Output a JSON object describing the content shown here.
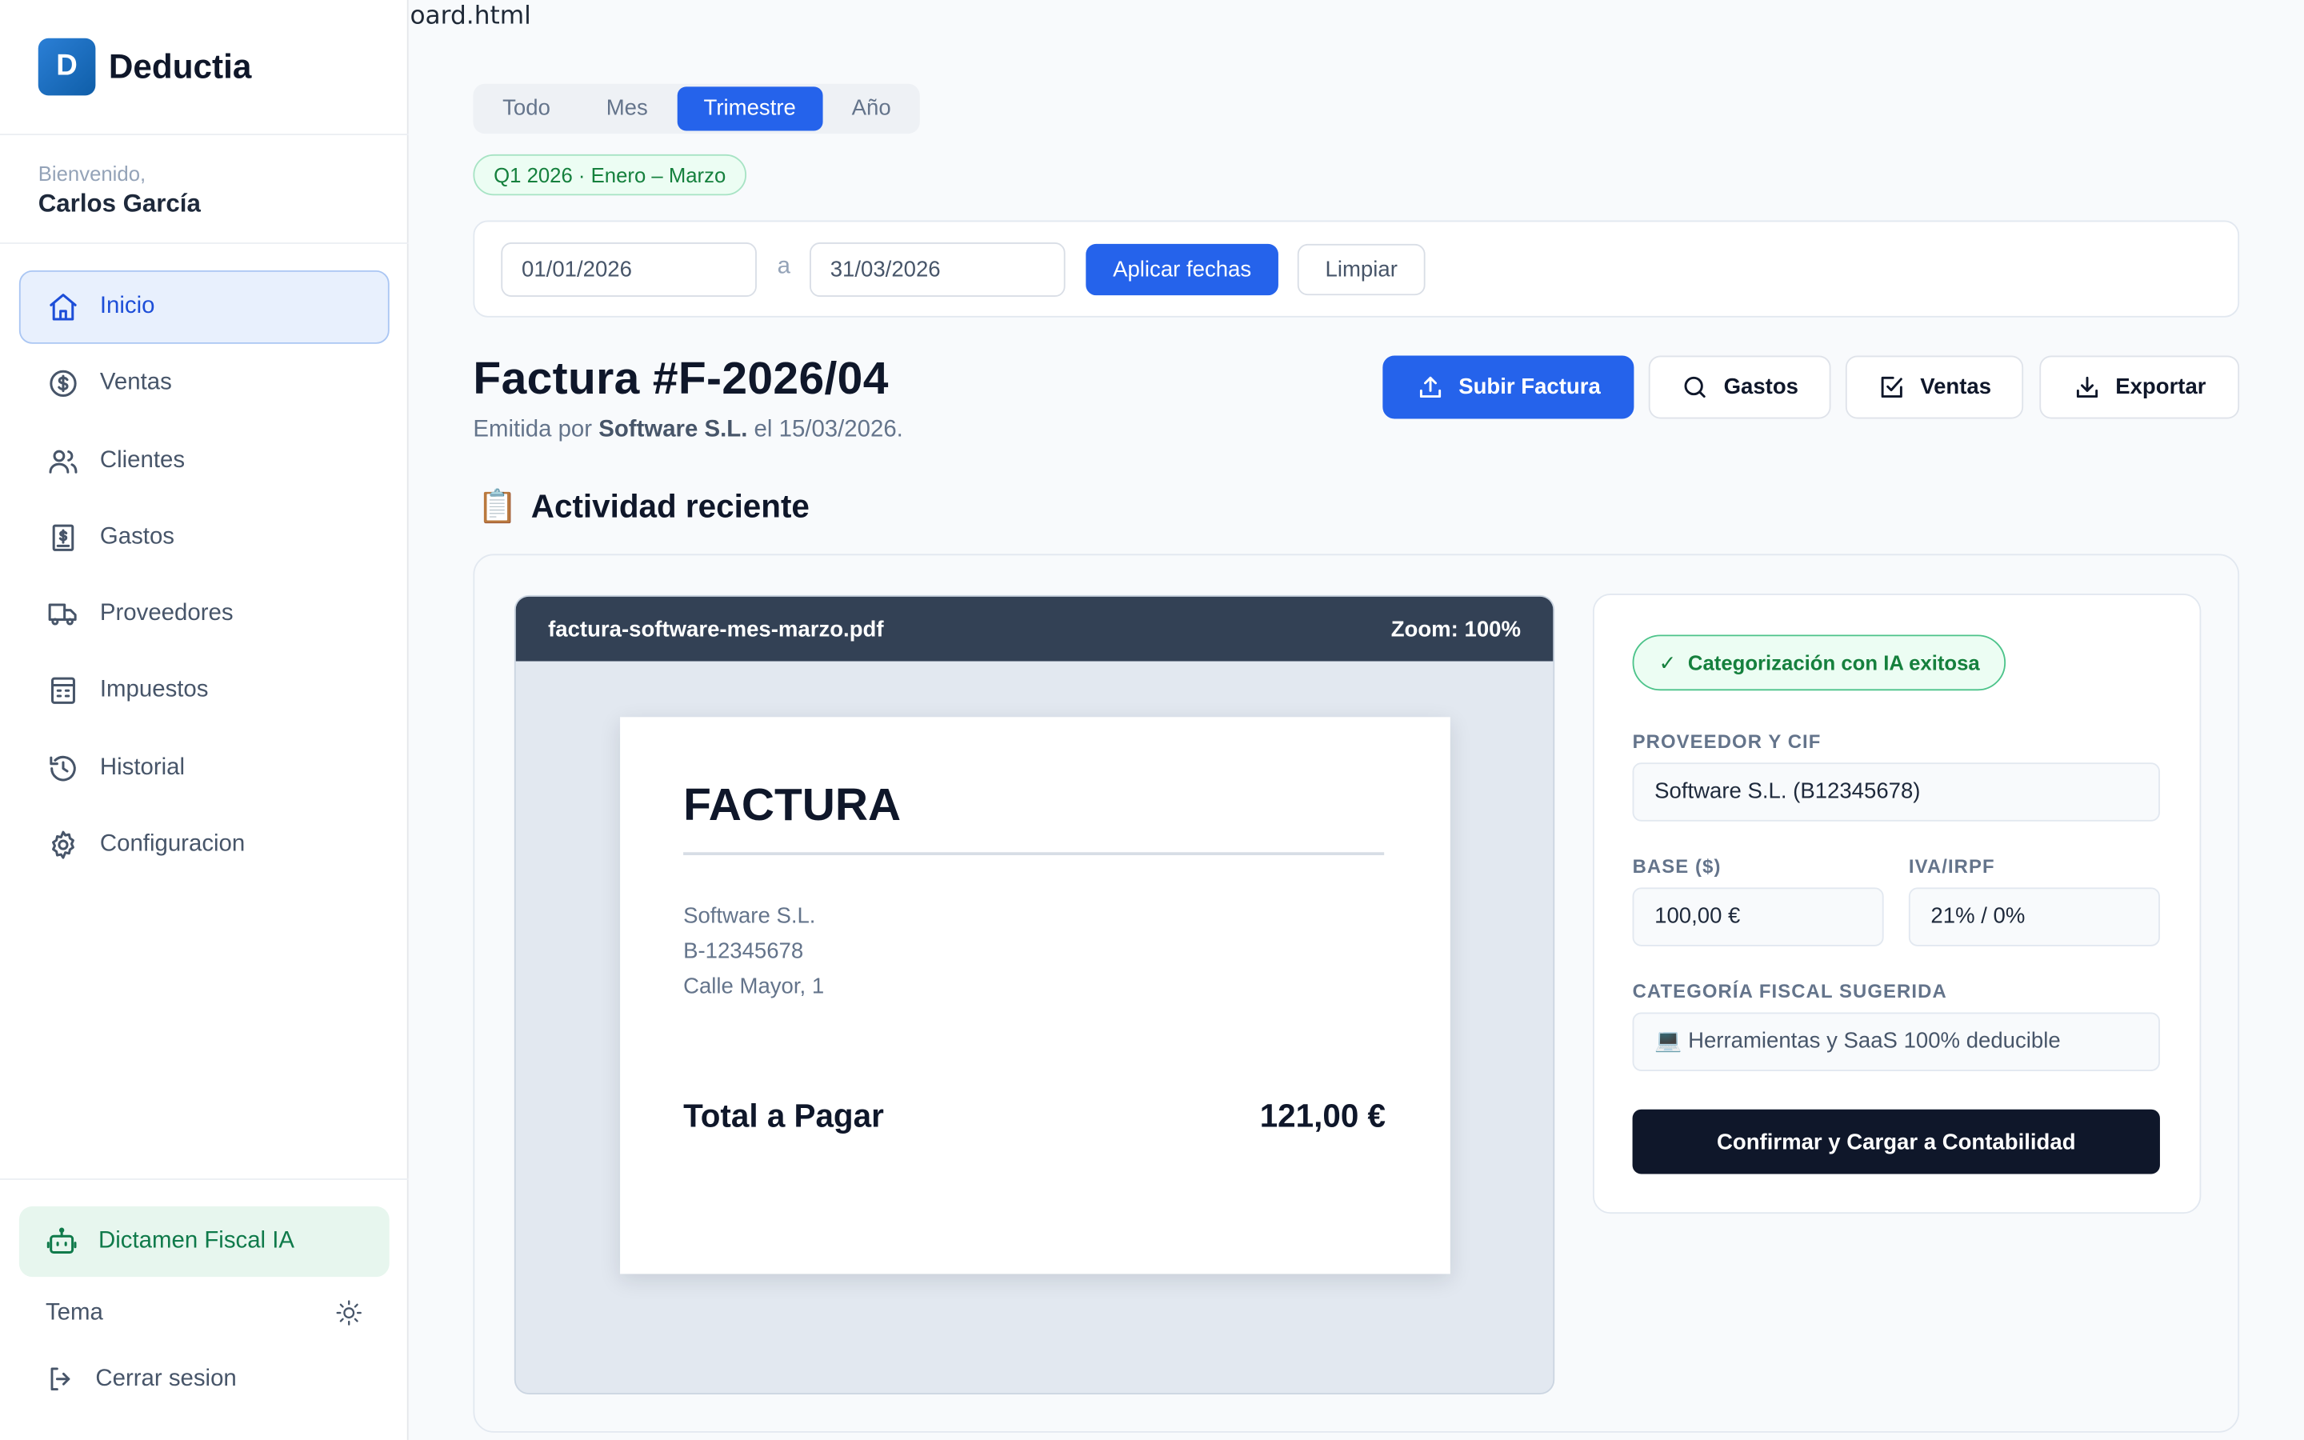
{
  "browser": {
    "filename_fragment": "oard.html"
  },
  "brand": {
    "logo_letter": "D",
    "name": "Deductia"
  },
  "user": {
    "welcome": "Bienvenido,",
    "name": "Carlos García"
  },
  "nav": {
    "items": [
      {
        "label": "Inicio",
        "icon": "home-icon",
        "active": true
      },
      {
        "label": "Ventas",
        "icon": "dollar-circle-icon"
      },
      {
        "label": "Clientes",
        "icon": "users-icon"
      },
      {
        "label": "Gastos",
        "icon": "receipt-icon"
      },
      {
        "label": "Proveedores",
        "icon": "truck-icon"
      },
      {
        "label": "Impuestos",
        "icon": "calculator-icon"
      },
      {
        "label": "Historial",
        "icon": "history-icon"
      },
      {
        "label": "Configuracion",
        "icon": "gear-icon"
      }
    ]
  },
  "sidebar_footer": {
    "ai_label": "Dictamen Fiscal IA",
    "theme_label": "Tema",
    "logout_label": "Cerrar sesion"
  },
  "period": {
    "tabs": [
      "Todo",
      "Mes",
      "Trimestre",
      "Año"
    ],
    "active": "Trimestre",
    "badge": "Q1 2026 · Enero – Marzo"
  },
  "dates": {
    "from": "01/01/2026",
    "separator": "a",
    "to": "31/03/2026",
    "apply_label": "Aplicar fechas",
    "clear_label": "Limpiar"
  },
  "invoice": {
    "title": "Factura #F-2026/04",
    "sub_prefix": "Emitida por ",
    "sub_company": "Software S.L.",
    "sub_suffix": " el 15/03/2026."
  },
  "actions": {
    "upload": "Subir Factura",
    "expenses": "Gastos",
    "sales": "Ventas",
    "export": "Exportar"
  },
  "activity": {
    "icon": "📋",
    "title": "Actividad reciente"
  },
  "viewer": {
    "filename": "factura-software-mes-marzo.pdf",
    "zoom": "Zoom: 100%",
    "doc_heading": "FACTURA",
    "address_lines": [
      "Software S.L.",
      "B-12345678",
      "Calle Mayor, 1"
    ],
    "total_label": "Total a Pagar",
    "total_value": "121,00 €"
  },
  "form": {
    "ai_status": "Categorización con IA exitosa",
    "supplier_label": "PROVEEDOR Y CIF",
    "supplier_value": "Software S.L. (B12345678)",
    "base_label": "BASE ($)",
    "base_value": "100,00 €",
    "tax_label": "IVA/IRPF",
    "tax_value": "21% / 0%",
    "category_label": "CATEGORÍA FISCAL SUGERIDA",
    "category_value": "💻 Herramientas y SaaS 100% deducible",
    "confirm_label": "Confirmar y Cargar a Contabilidad"
  },
  "colors": {
    "primary": "#2563eb",
    "success": "#15803d",
    "dark": "#0f172a",
    "viewer_bar": "#334155"
  }
}
